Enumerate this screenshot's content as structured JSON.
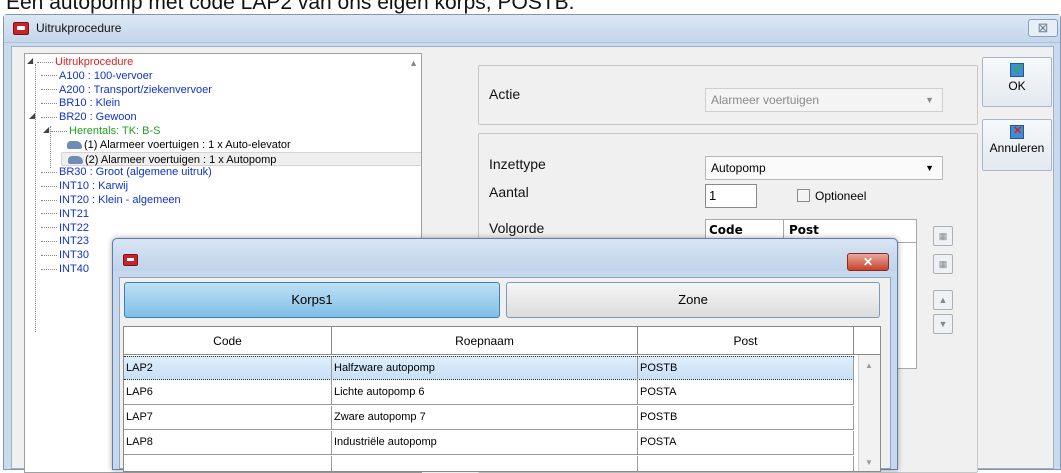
{
  "caption": "Een autopomp met code LAP2 van ons eigen korps, POSTB.",
  "window": {
    "title": "Uitrukprocedure",
    "close_glyph": "⊠"
  },
  "tree": {
    "items": [
      {
        "label": "Uitrukprocedure",
        "color": "red",
        "level": 0,
        "expander": "◢"
      },
      {
        "label": "A100 : 100-vervoer",
        "color": "blue",
        "level": 1
      },
      {
        "label": "A200 : Transport/ziekenvervoer",
        "color": "blue",
        "level": 1
      },
      {
        "label": "BR10 : Klein",
        "color": "blue",
        "level": 1
      },
      {
        "label": "BR20 : Gewoon",
        "color": "blue",
        "level": 1,
        "expander": "◢"
      },
      {
        "label": "Herentals: TK: B-S",
        "color": "green",
        "level": 2,
        "expander": "◢"
      },
      {
        "label": "(1) Alarmeer voertuigen : 1 x Auto-elevator",
        "color": "black",
        "level": 3
      },
      {
        "label": "(2) Alarmeer voertuigen : 1 x Autopomp",
        "color": "black",
        "level": 3,
        "selected": true
      },
      {
        "label": "BR30 : Groot (algemene uitruk)",
        "color": "blue",
        "level": 1
      },
      {
        "label": "INT10 : Karwij",
        "color": "blue",
        "level": 1
      },
      {
        "label": "INT20 : Klein - algemeen",
        "color": "blue",
        "level": 1
      },
      {
        "label": "INT21",
        "color": "blue",
        "level": 1
      },
      {
        "label": "INT22",
        "color": "blue",
        "level": 1
      },
      {
        "label": "INT23",
        "color": "blue",
        "level": 1
      },
      {
        "label": "INT30",
        "color": "blue",
        "level": 1
      },
      {
        "label": "INT40",
        "color": "blue",
        "level": 1
      }
    ]
  },
  "form": {
    "actie_label": "Actie",
    "actie_value": "Alarmeer voertuigen",
    "inzettype_label": "Inzettype",
    "inzettype_value": "Autopomp",
    "aantal_label": "Aantal",
    "aantal_value": "1",
    "optioneel_label": "Optioneel",
    "volgorde_label": "Volgorde",
    "volgorde_columns": [
      "Code",
      "Post"
    ]
  },
  "buttons": {
    "ok": "OK",
    "annuleren": "Annuleren"
  },
  "dialog": {
    "close_glyph": "✕",
    "tabs": [
      {
        "label": "Korps1",
        "active": true
      },
      {
        "label": "Zone",
        "active": false
      }
    ],
    "columns": [
      "Code",
      "Roepnaam",
      "Post"
    ],
    "rows": [
      {
        "code": "LAP2",
        "roepnaam": "Halfzware autopomp",
        "post": "POSTB",
        "selected": true
      },
      {
        "code": "LAP6",
        "roepnaam": "Lichte autopomp 6",
        "post": "POSTA"
      },
      {
        "code": "LAP7",
        "roepnaam": "Zware autopomp 7",
        "post": "POSTB"
      },
      {
        "code": "LAP8",
        "roepnaam": "Industriële autopomp",
        "post": "POSTA"
      }
    ]
  }
}
